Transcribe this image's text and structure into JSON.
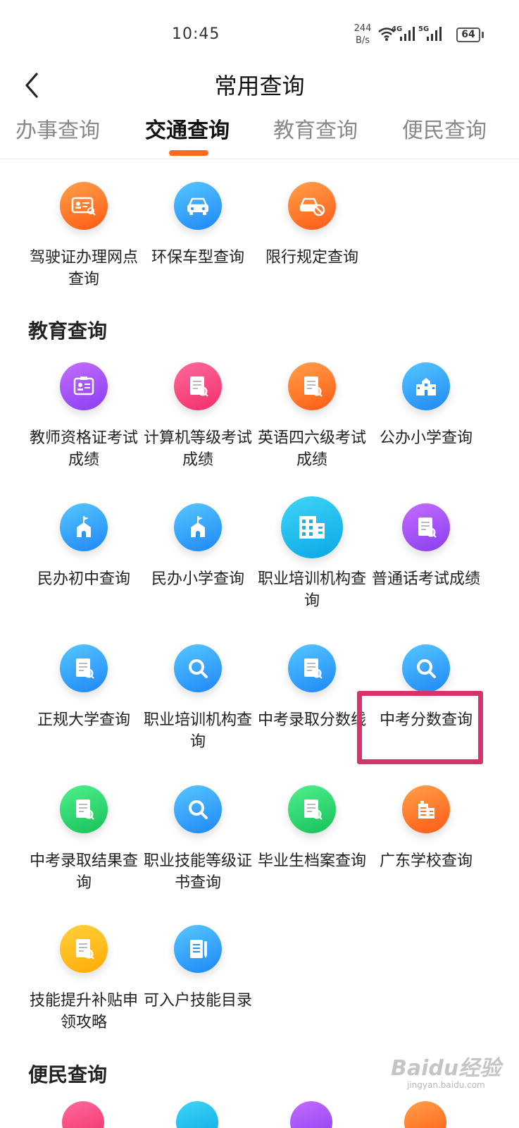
{
  "status": {
    "time": "10:45",
    "speed_value": "244",
    "speed_unit": "B/s",
    "net1": "4G",
    "net2": "5G",
    "battery": "64"
  },
  "header": {
    "title": "常用查询"
  },
  "tabs": [
    {
      "label": "办事查询",
      "active": false
    },
    {
      "label": "交通查询",
      "active": true
    },
    {
      "label": "教育查询",
      "active": false
    },
    {
      "label": "便民查询",
      "active": false
    }
  ],
  "traffic_items": [
    {
      "label": "驾驶证办理网点查询",
      "icon": "id-card-search-icon",
      "color": "orange"
    },
    {
      "label": "环保车型查询",
      "icon": "car-icon",
      "color": "blue"
    },
    {
      "label": "限行规定查询",
      "icon": "car-forbidden-icon",
      "color": "orange"
    }
  ],
  "education": {
    "title": "教育查询",
    "items": [
      {
        "label": "教师资格证考试成绩",
        "icon": "badge-icon",
        "color": "purple"
      },
      {
        "label": "计算机等级考试成绩",
        "icon": "document-search-icon",
        "color": "pink"
      },
      {
        "label": "英语四六级考试成绩",
        "icon": "document-search-icon",
        "color": "orange"
      },
      {
        "label": "公办小学查询",
        "icon": "school-building-icon",
        "color": "blue"
      },
      {
        "label": "民办初中查询",
        "icon": "school-flag-icon",
        "color": "blue"
      },
      {
        "label": "民办小学查询",
        "icon": "school-flag-icon",
        "color": "blue"
      },
      {
        "label": "职业培训机构查询",
        "icon": "office-building-icon",
        "color": "cyan"
      },
      {
        "label": "普通话考试成绩",
        "icon": "document-search-icon",
        "color": "purple"
      },
      {
        "label": "正规大学查询",
        "icon": "document-search-icon",
        "color": "blue"
      },
      {
        "label": "职业培训机构查询",
        "icon": "magnifier-icon",
        "color": "blue"
      },
      {
        "label": "中考录取分数线",
        "icon": "document-search-icon",
        "color": "blue"
      },
      {
        "label": "中考分数查询",
        "icon": "magnifier-icon",
        "color": "blue"
      },
      {
        "label": "中考录取结果查询",
        "icon": "document-search-icon",
        "color": "green"
      },
      {
        "label": "职业技能等级证书查询",
        "icon": "magnifier-icon",
        "color": "blue"
      },
      {
        "label": "毕业生档案查询",
        "icon": "document-search-icon",
        "color": "green"
      },
      {
        "label": "广东学校查询",
        "icon": "building-icon",
        "color": "orange"
      },
      {
        "label": "技能提升补贴申领攻略",
        "icon": "document-search-icon",
        "color": "yellow"
      },
      {
        "label": "可入户技能目录",
        "icon": "notebook-pen-icon",
        "color": "blue"
      }
    ]
  },
  "convenience": {
    "title": "便民查询"
  },
  "watermark": {
    "brand": "Baidu经验",
    "url": "jingyan.baidu.com"
  }
}
